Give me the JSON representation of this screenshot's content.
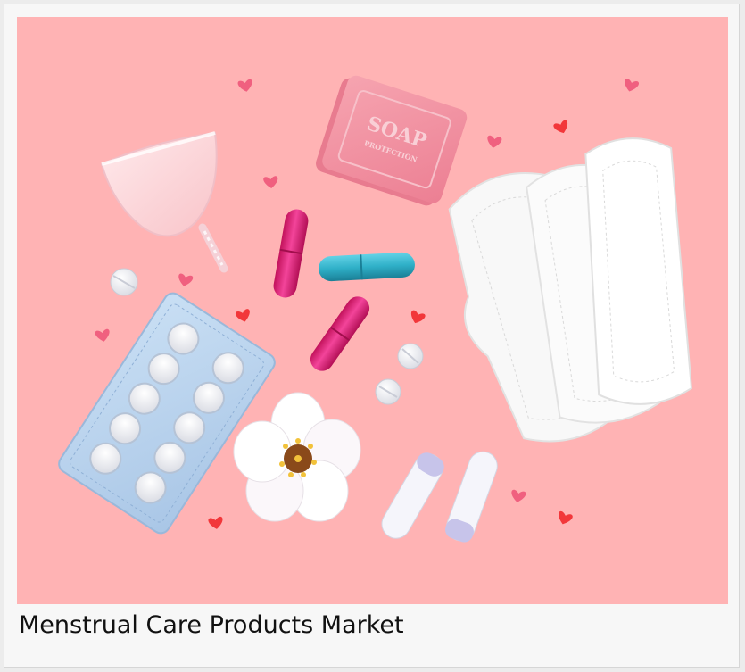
{
  "figure": {
    "caption": "Menstrual Care Products Market",
    "background_color": "#ffb3b4",
    "soap": {
      "line1": "SOAP",
      "line2": "PROTECTION"
    },
    "heart_color_dark": "#f2373a",
    "heart_color_pink": "#f0607f"
  }
}
